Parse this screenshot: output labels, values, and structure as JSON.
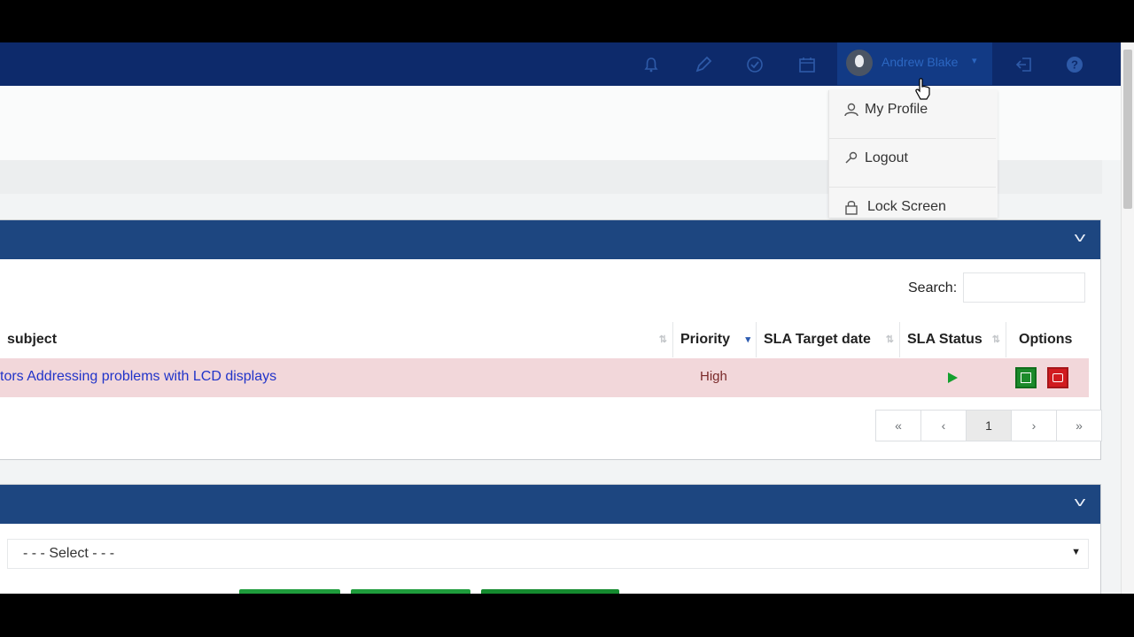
{
  "user": {
    "name": "Andrew Blake"
  },
  "topbar_icons": [
    "bell-icon",
    "pencil-icon",
    "check-circle-icon",
    "calendar-icon",
    "sign-out-icon",
    "help-icon"
  ],
  "dropdown": [
    {
      "label": "My Profile",
      "icon": "user-icon"
    },
    {
      "label": "Logout",
      "icon": "key-icon"
    },
    {
      "label": "Lock Screen",
      "icon": "lock-icon"
    }
  ],
  "table": {
    "search_label": "Search:",
    "columns": [
      "subject",
      "Priority",
      "SLA Target date",
      "SLA Status",
      "Options"
    ],
    "rows": [
      {
        "subject": "tors Addressing problems with LCD displays",
        "priority": "High",
        "sla_target_date": "",
        "sla_status": "play-icon"
      }
    ],
    "pagination": [
      "«",
      "‹",
      "1",
      "›",
      "»"
    ],
    "active_page": "1"
  },
  "filter_panel": {
    "select_value": "- - - Select - - -"
  },
  "colors": {
    "topbar": "#0d2a6b",
    "panel_header": "#1d4680",
    "row_highlight": "#f2d7da",
    "link": "#2134c9",
    "success": "#1c8a2b",
    "danger": "#d11b1f"
  }
}
